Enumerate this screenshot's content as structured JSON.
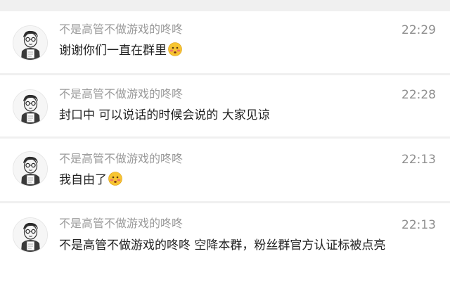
{
  "messages": [
    {
      "sender": "不是高管不做游戏的咚咚",
      "time": "22:29",
      "text": "谢谢你们一直在群里",
      "emoji": "blushing-face-emoji"
    },
    {
      "sender": "不是高管不做游戏的咚咚",
      "time": "22:28",
      "text": "封口中 可以说话的时候会说的 大家见谅",
      "emoji": ""
    },
    {
      "sender": "不是高管不做游戏的咚咚",
      "time": "22:13",
      "text": "我自由了",
      "emoji": "blushing-face-emoji"
    },
    {
      "sender": "不是高管不做游戏的咚咚",
      "time": "22:13",
      "text": "不是高管不做游戏的咚咚 空降本群，粉丝群官方认证标被点亮",
      "emoji": ""
    }
  ],
  "colors": {
    "background": "#f0f0f0",
    "card": "#ffffff",
    "sender": "#9a9a9a",
    "time": "#8e8e8e",
    "text": "#222222"
  }
}
